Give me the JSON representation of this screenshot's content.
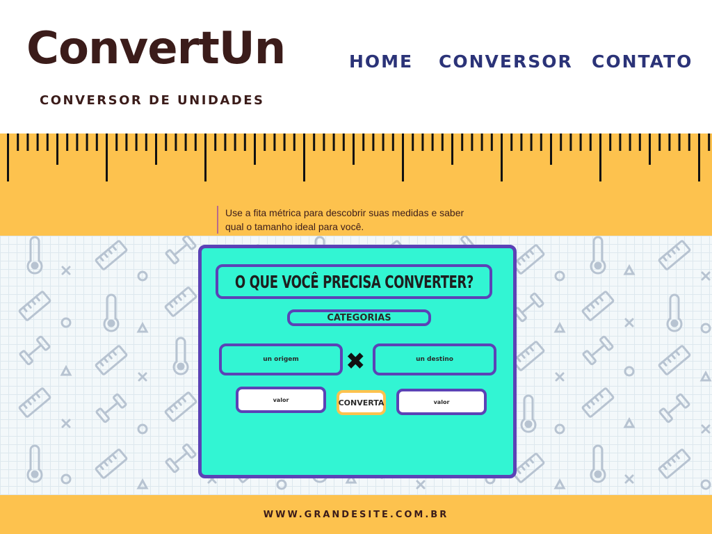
{
  "brand": {
    "logo": "ConvertUn",
    "subtitle": "CONVERSOR DE UNIDADES"
  },
  "nav": {
    "items": [
      {
        "label": "HOME"
      },
      {
        "label": "CONVERSOR"
      },
      {
        "label": "CONTATO"
      }
    ]
  },
  "ruler": {
    "tip": "Use a fita métrica para descobrir suas medidas e saber qual o tamanho ideal para você."
  },
  "converter": {
    "title": "O QUE VOCÊ PRECISA CONVERTER?",
    "categories_label": "CATEGORIAS",
    "origin_unit_label": "un origem",
    "target_unit_label": "un destino",
    "swap_symbol": "✖",
    "value_input_label": "valor",
    "value_output_label": "valor",
    "convert_label": "CONVERTA"
  },
  "footer": {
    "site": "WWW.GRANDESITE.COM.BR"
  },
  "colors": {
    "ruler_yellow": "#fdc24e",
    "card_teal": "#32f5d3",
    "card_border": "#5b42b6",
    "nav_blue": "#2b3378",
    "brand_brown": "#3b1c1a",
    "pattern_icon": "#b7c3d1"
  },
  "pattern_icons": [
    "ruler-icon",
    "thermometer-icon",
    "dumbbell-icon",
    "circle-icon",
    "triangle-icon",
    "cross-icon"
  ]
}
